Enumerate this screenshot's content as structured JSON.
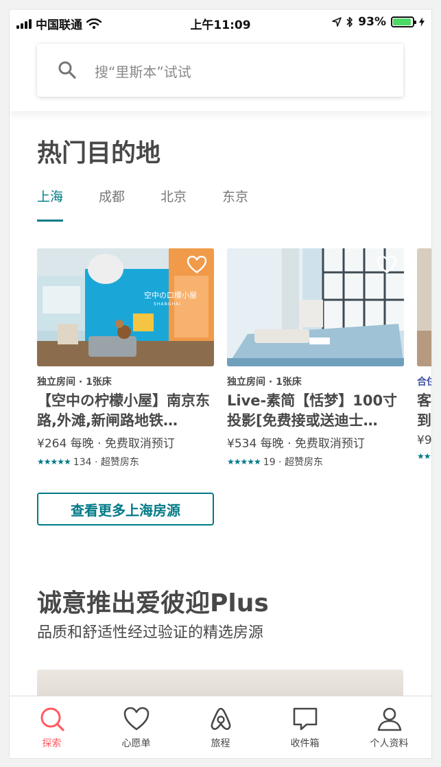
{
  "status_bar": {
    "carrier": "中国联通",
    "time": "上午11:09",
    "battery": "93%"
  },
  "search": {
    "placeholder": "搜“里斯本”试试"
  },
  "popular": {
    "title": "热门目的地",
    "tabs": [
      {
        "label": "上海",
        "active": true
      },
      {
        "label": "成都",
        "active": false
      },
      {
        "label": "北京",
        "active": false
      },
      {
        "label": "东京",
        "active": false
      }
    ],
    "listings": [
      {
        "type": "独立房间 · 1张床",
        "title": "【空中の柠檬小屋】南京东路,外滩,新闸路地铁…",
        "price": "¥264 每晚 · 免费取消预订",
        "reviews": "134 · 超赞房东",
        "photo_sign": "空中の口檬小屋",
        "photo_sign_sub": "SHANGHAI"
      },
      {
        "type": "独立房间 · 1张床",
        "title": "Live-素简【恬梦】100寸投影[免费接或送迪士…",
        "price": "¥534 每晚 · 免费取消预订",
        "reviews": "19 · 超赞房东"
      },
      {
        "type": "合住",
        "title": "客到",
        "price": "¥9",
        "reviews": ""
      }
    ],
    "more_button": "查看更多上海房源"
  },
  "plus": {
    "title": "诚意推出爱彼迎Plus",
    "subtitle": "品质和舒适性经过验证的精选房源"
  },
  "tabbar": [
    {
      "label": "探索",
      "icon": "search-icon",
      "active": true
    },
    {
      "label": "心愿单",
      "icon": "heart-icon",
      "active": false
    },
    {
      "label": "旅程",
      "icon": "airbnb-logo-icon",
      "active": false
    },
    {
      "label": "收件箱",
      "icon": "chat-bubble-icon",
      "active": false
    },
    {
      "label": "个人资料",
      "icon": "person-icon",
      "active": false
    }
  ],
  "colors": {
    "accent": "#007a87",
    "active_tab": "#ff5a5f",
    "battery": "#4cd964"
  }
}
